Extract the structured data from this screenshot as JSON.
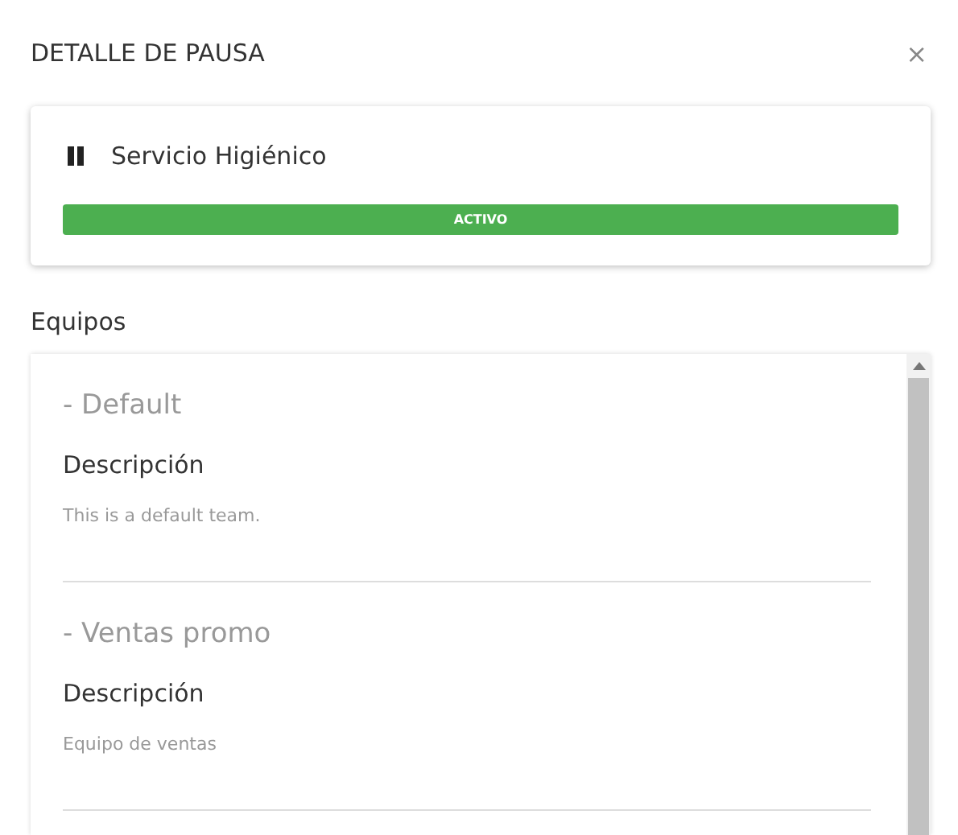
{
  "dialog": {
    "title": "DETALLE DE PAUSA",
    "close": "×"
  },
  "pause": {
    "name": "Servicio Higiénico",
    "status": {
      "label": "ACTIVO",
      "kind": "active"
    }
  },
  "teams_heading": "Equipos",
  "teams": [
    {
      "name": "- Default",
      "description_label": "Descripción",
      "description": "This is a default team."
    },
    {
      "name": "- Ventas promo",
      "description_label": "Descripción",
      "description": "Equipo de ventas"
    }
  ]
}
